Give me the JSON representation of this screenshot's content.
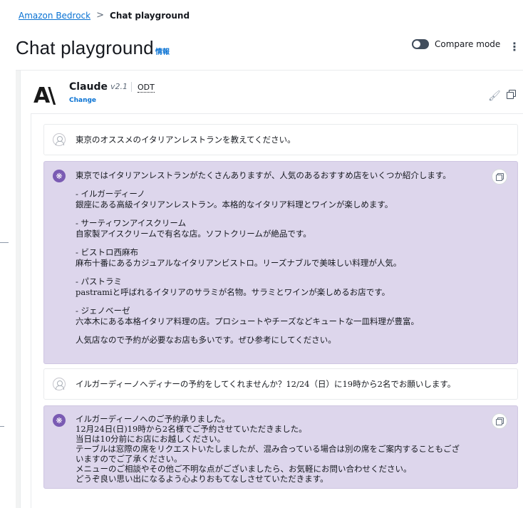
{
  "breadcrumb": {
    "root": "Amazon Bedrock",
    "separator": ">",
    "current": "Chat playground"
  },
  "header": {
    "title": "Chat playground",
    "info_link": "情報",
    "compare_mode_label": "Compare mode",
    "compare_mode_on": false,
    "menu_icon": "kebab-icon"
  },
  "model": {
    "logo_text": "A\\",
    "name": "Claude",
    "version": "v2.1",
    "odt": "ODT",
    "change_label": "Change",
    "clear_icon": "brush-icon",
    "copy_icon": "copy-icon"
  },
  "messages": [
    {
      "role": "user",
      "text": "東京のオススメのイタリアンレストランを教えてください。"
    },
    {
      "role": "assistant",
      "intro": "東京ではイタリアンレストランがたくさんありますが、人気のあるおすすめ店をいくつか紹介します。",
      "items": [
        {
          "name": "- イルガーディーノ",
          "desc": "銀座にある高級イタリアンレストラン。本格的なイタリア料理とワインが楽しめます。"
        },
        {
          "name": "- サーティワンアイスクリーム",
          "desc": "自家製アイスクリームで有名な店。ソフトクリームが絶品です。"
        },
        {
          "name": "- ビストロ西麻布",
          "desc": "麻布十番にあるカジュアルなイタリアンビストロ。リーズナブルで美味しい料理が人気。"
        },
        {
          "name": "- パストラミ",
          "desc": " pastramiと呼ばれるイタリアのサラミが名物。サラミとワインが楽しめるお店です。"
        },
        {
          "name": "- ジェノベーゼ",
          "desc": "六本木にある本格イタリア料理の店。プロシュートやチーズなどキュートな一皿料理が豊富。"
        }
      ],
      "outro": "人気店なので予約が必要なお店も多いです。ぜひ参考にしてください。"
    },
    {
      "role": "user",
      "text": "イルガーディーノへディナーの予約をしてくれませんか？12/24（日）に19時から2名でお願いします。"
    },
    {
      "role": "assistant",
      "lines": [
        "イルガーディーノへのご予約承りました。",
        "12月24日(日)19時から2名様でご予約させていただきました。",
        "当日は10分前にお店にお越しください。",
        "テーブルは窓際の席をリクエストいたしましたが、混み合っている場合は別の席をご案内することもござ",
        "いますのでご了承ください。",
        "メニューのご相談やその他ご不明な点がございましたら、お気軽にお問い合わせください。",
        "どうぞ良い思い出になるよう心よりおもてなしさせていただきます。"
      ]
    }
  ],
  "colors": {
    "link": "#0972d3",
    "assistant_bg": "#ddd6ec",
    "avatar_ai": "#7a5bb3"
  }
}
